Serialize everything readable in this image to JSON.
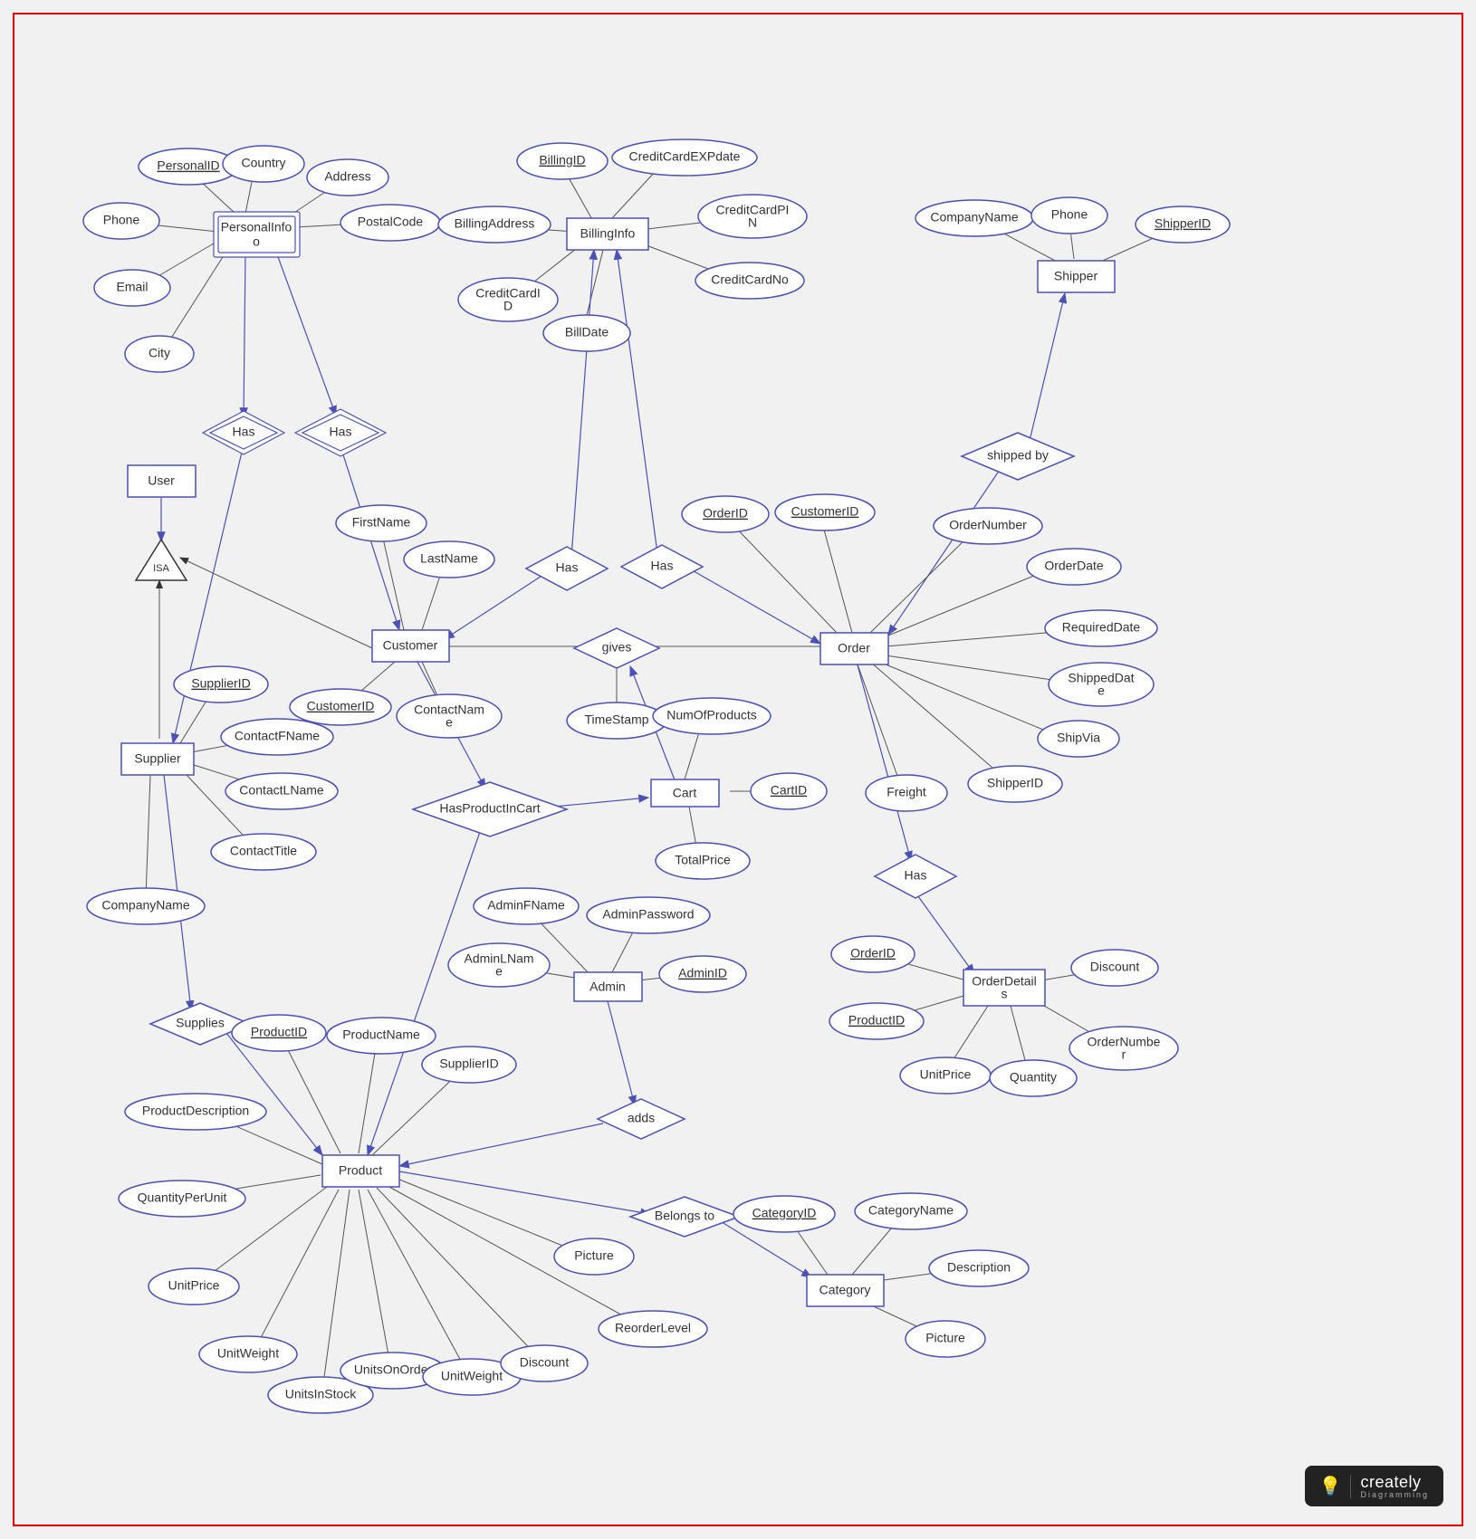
{
  "brand": {
    "name": "creately",
    "sub": "Diagramming"
  },
  "entities": {
    "personalinfo": "PersonalInfo",
    "billinginfo": "BillingInfo",
    "shipper": "Shipper",
    "user": "User",
    "customer": "Customer",
    "order": "Order",
    "cart": "Cart",
    "supplier": "Supplier",
    "admin": "Admin",
    "orderdetails": "OrderDetails",
    "product": "Product",
    "category": "Category"
  },
  "isa": "ISA",
  "rels": {
    "has_pi1": "Has",
    "has_pi2": "Has",
    "has_bi1": "Has",
    "has_bi2": "Has",
    "shipped_by": "shipped by",
    "gives": "gives",
    "has_pic": "HasProductInCart",
    "has_od": "Has",
    "supplies": "Supplies",
    "adds": "adds",
    "belongs": "Belongs to"
  },
  "attrs": {
    "pi_personalid": "PersonalID",
    "pi_country": "Country",
    "pi_address": "Address",
    "pi_postal": "PostalCode",
    "pi_phone": "Phone",
    "pi_email": "Email",
    "pi_city": "City",
    "bi_billingid": "BillingID",
    "bi_ccexp": "CreditCardEXPdate",
    "bi_baddr": "BillingAddress",
    "bi_ccpin": "CreditCardPIN",
    "bi_ccid": "CreditCardID",
    "bi_billdate": "BillDate",
    "bi_ccno": "CreditCardNo",
    "sh_company": "CompanyName",
    "sh_phone": "Phone",
    "sh_id": "ShipperID",
    "c_first": "FirstName",
    "c_last": "LastName",
    "c_id": "CustomerID",
    "c_contact": "ContactName",
    "o_id": "OrderID",
    "o_custid": "CustomerID",
    "o_num": "OrderNumber",
    "o_date": "OrderDate",
    "o_req": "RequiredDate",
    "o_shipdate": "ShippedDate",
    "o_shipvia": "ShipVia",
    "o_shipperid": "ShipperID",
    "o_freight": "Freight",
    "g_ts": "TimeStamp",
    "cart_num": "NumOfProducts",
    "cart_id": "CartID",
    "cart_total": "TotalPrice",
    "sup_id": "SupplierID",
    "sup_fn": "ContactFName",
    "sup_ln": "ContactLName",
    "sup_title": "ContactTitle",
    "sup_company": "CompanyName",
    "adm_fn": "AdminFName",
    "adm_ln": "AdminLName",
    "adm_pw": "AdminPassword",
    "adm_id": "AdminID",
    "od_oid": "OrderID",
    "od_pid": "ProductID",
    "od_up": "UnitPrice",
    "od_qty": "Quantity",
    "od_disc": "Discount",
    "od_num": "OrderNumber",
    "p_id": "ProductID",
    "p_name": "ProductName",
    "p_supid": "SupplierID",
    "p_desc": "ProductDescription",
    "p_qpu": "QuantityPerUnit",
    "p_up": "UnitPrice",
    "p_uw1": "UnitWeight",
    "p_uis": "UnitsInStock",
    "p_uoo": "UnitsOnOrder",
    "p_uw2": "UnitWeight",
    "p_disc": "Discount",
    "p_reorder": "ReorderLevel",
    "p_pic": "Picture",
    "cat_id": "CategoryID",
    "cat_name": "CategoryName",
    "cat_desc": "Description",
    "cat_pic": "Picture"
  }
}
